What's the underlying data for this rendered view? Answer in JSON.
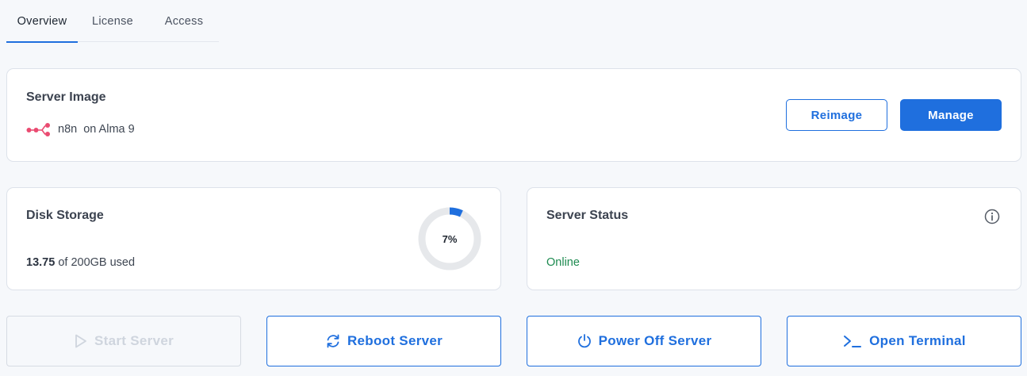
{
  "tabs": [
    {
      "label": "Overview",
      "active": true
    },
    {
      "label": "License",
      "active": false
    },
    {
      "label": "Access",
      "active": false
    }
  ],
  "server_image": {
    "title": "Server Image",
    "app_name": "n8n",
    "os_text": "on Alma 9",
    "logo_icon": "n8n-logo-icon",
    "reimage_label": "Reimage",
    "manage_label": "Manage"
  },
  "disk_storage": {
    "title": "Disk Storage",
    "used_value": "13.75",
    "used_suffix": "of 200GB used",
    "percent_label": "7%",
    "percent_value": 7
  },
  "server_status": {
    "title": "Server Status",
    "status": "Online",
    "info_icon": "info-icon"
  },
  "actions": {
    "start": {
      "label": "Start Server",
      "icon": "play-icon",
      "disabled": true
    },
    "reboot": {
      "label": "Reboot Server",
      "icon": "refresh-icon",
      "disabled": false
    },
    "power_off": {
      "label": "Power Off Server",
      "icon": "power-icon",
      "disabled": false
    },
    "terminal": {
      "label": "Open Terminal",
      "icon": "terminal-icon",
      "disabled": false
    }
  },
  "colors": {
    "accent": "#1f6fde",
    "status_online": "#1c8a4f",
    "logo": "#ea4b71",
    "disabled": "#cfd5de"
  }
}
